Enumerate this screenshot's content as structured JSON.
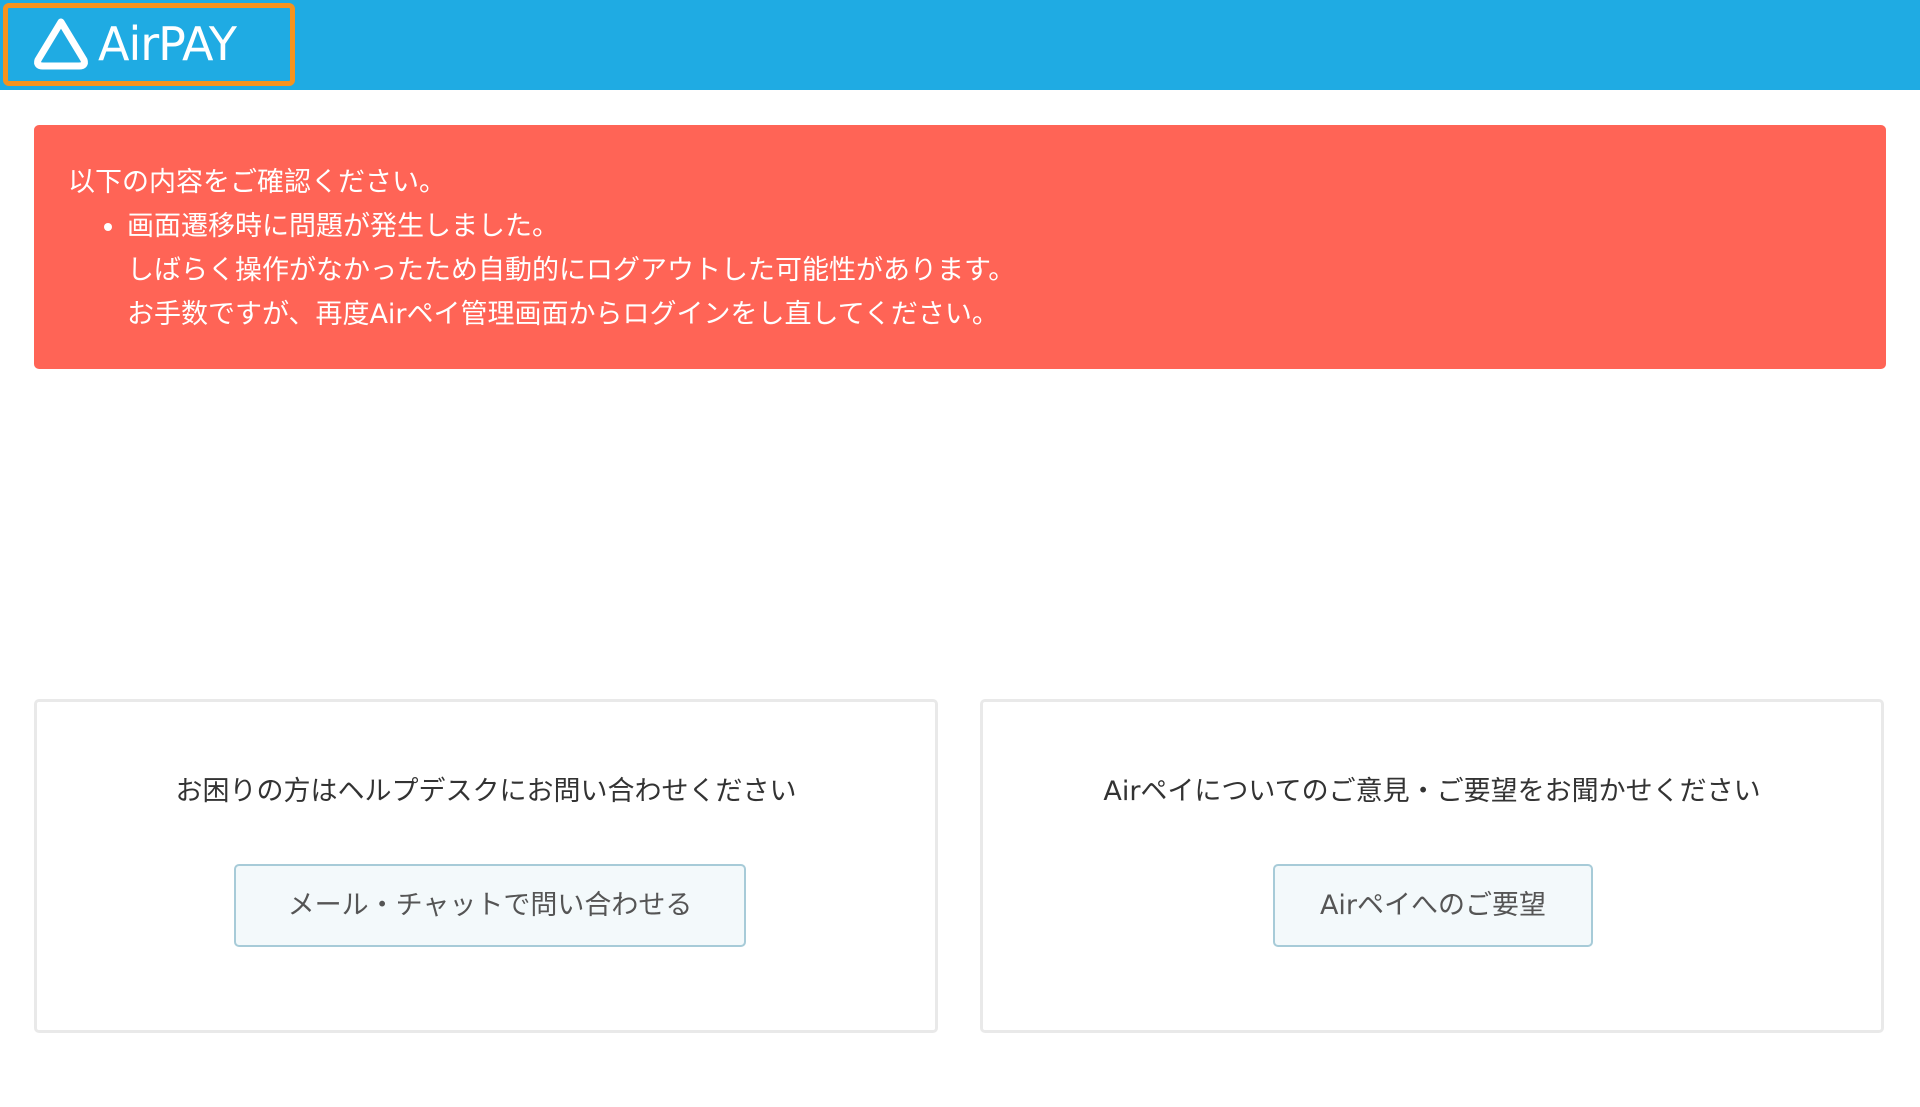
{
  "header": {
    "logo_text": "AirPAY",
    "background_color": "#1fabe3",
    "highlight_color": "#f7931e"
  },
  "alert": {
    "background_color": "#ff6456",
    "heading": "以下の内容をご確認ください。",
    "items": [
      {
        "lines": [
          "画面遷移時に問題が発生しました。",
          "しばらく操作がなかったため自動的にログアウトした可能性があります。",
          "お手数ですが、再度Airペイ管理画面からログインをし直してください。"
        ]
      }
    ]
  },
  "cards": {
    "help": {
      "text": "お困りの方はヘルプデスクにお問い合わせください",
      "button_label": "メール・チャットで問い合わせる"
    },
    "feedback": {
      "text": "Airペイについてのご意見・ご要望をお聞かせください",
      "button_label": "Airペイへのご要望"
    }
  }
}
